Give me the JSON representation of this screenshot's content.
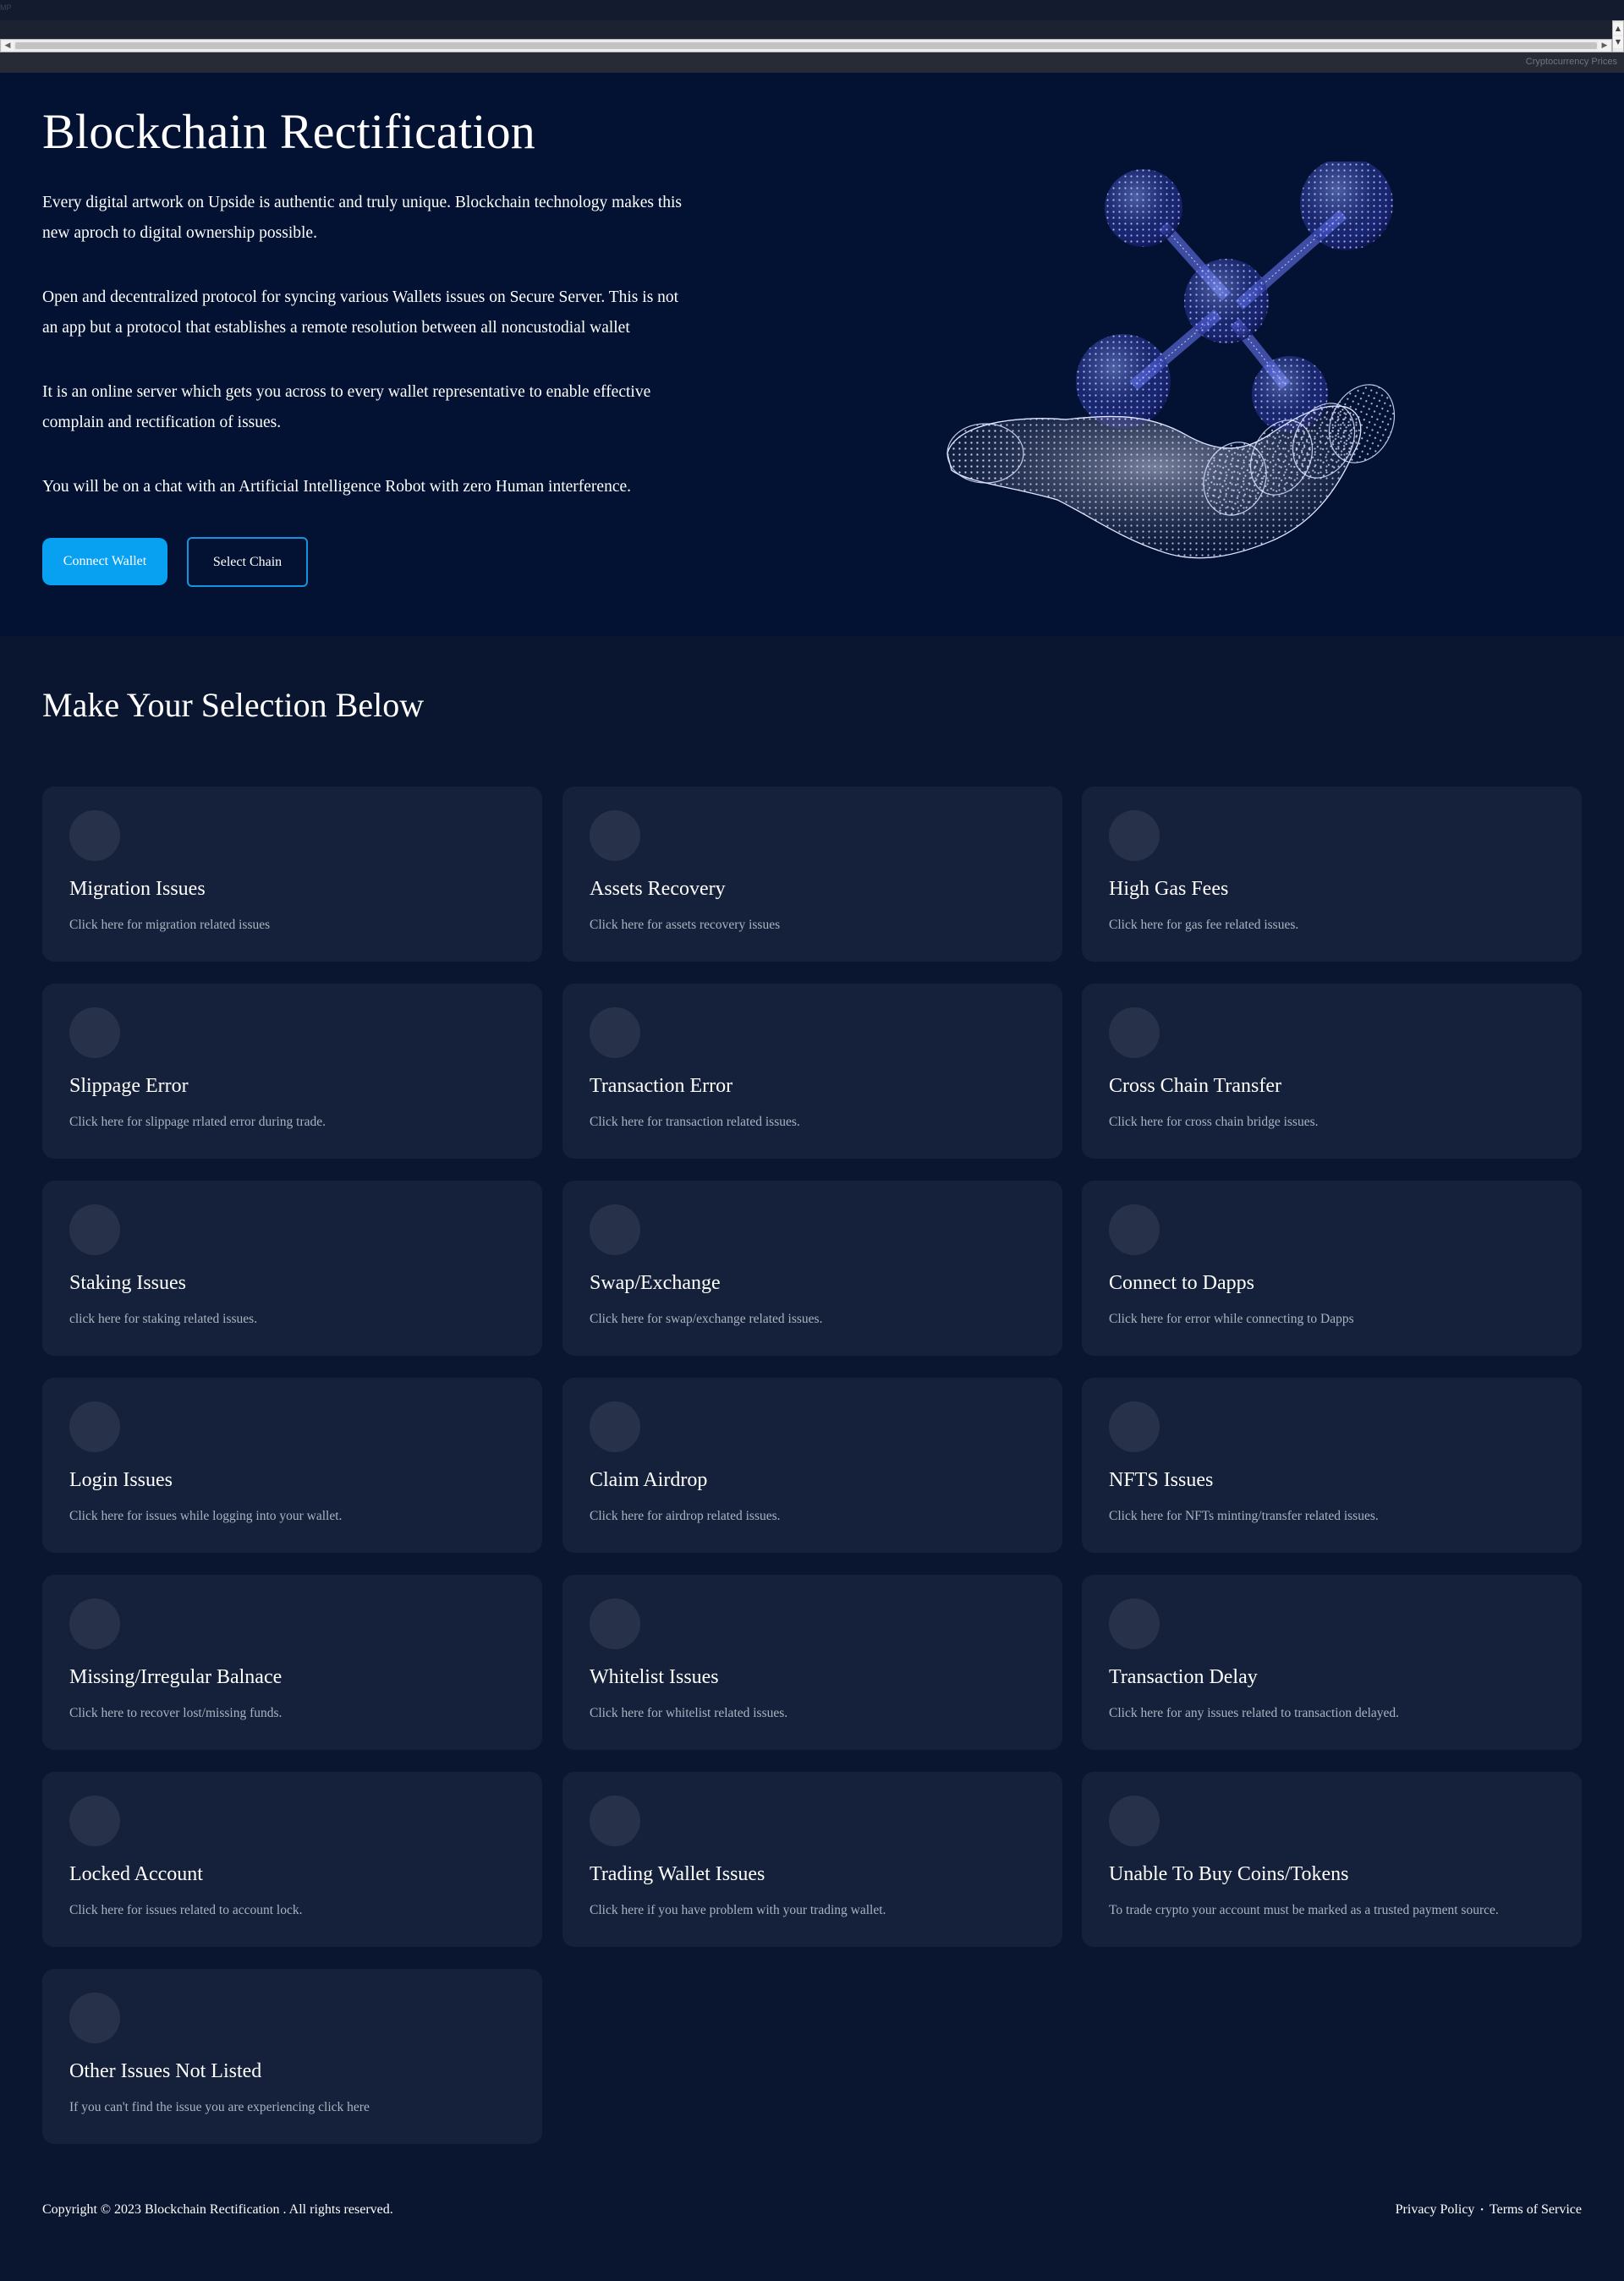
{
  "top_widget": {
    "corner_text": "MP",
    "credit": "Cryptocurrency Prices"
  },
  "hero": {
    "title": "Blockchain Rectification",
    "paragraphs": [
      "Every digital artwork on Upside is authentic and truly unique. Blockchain technology makes this new aproch to digital ownership possible.",
      "Open and decentralized protocol for syncing various Wallets issues on Secure Server. This is not an app but a protocol that establishes a remote resolution between all noncustodial wallet",
      "It is an online server which gets you across to every wallet representative to enable effective complain and rectification of issues.",
      "You will be on a chat with an Artificial Intelligence Robot with zero Human interference."
    ],
    "connect_button": "Connect Wallet",
    "chain_button": "Select Chain",
    "accent_color": "#08a0f0"
  },
  "selection": {
    "title": "Make Your Selection Below",
    "cards": [
      {
        "title": "Migration Issues",
        "desc": "Click here for migration related issues"
      },
      {
        "title": "Assets Recovery",
        "desc": "Click here for assets recovery issues"
      },
      {
        "title": "High Gas Fees",
        "desc": "Click here for gas fee related issues."
      },
      {
        "title": "Slippage Error",
        "desc": "Click here for slippage rrlated error during trade."
      },
      {
        "title": "Transaction Error",
        "desc": "Click here for transaction related issues."
      },
      {
        "title": "Cross Chain Transfer",
        "desc": "Click here for cross chain bridge issues."
      },
      {
        "title": "Staking Issues",
        "desc": "click here for staking related issues."
      },
      {
        "title": "Swap/Exchange",
        "desc": "Click here for swap/exchange related issues."
      },
      {
        "title": "Connect to Dapps",
        "desc": "Click here for error while connecting to Dapps"
      },
      {
        "title": "Login Issues",
        "desc": "Click here for issues while logging into your wallet."
      },
      {
        "title": "Claim Airdrop",
        "desc": "Click here for airdrop related issues."
      },
      {
        "title": "NFTS Issues",
        "desc": "Click here for NFTs minting/transfer related issues."
      },
      {
        "title": "Missing/Irregular Balnace",
        "desc": "Click here to recover lost/missing funds."
      },
      {
        "title": "Whitelist Issues",
        "desc": "Click here for whitelist related issues."
      },
      {
        "title": "Transaction Delay",
        "desc": "Click here for any issues related to transaction delayed."
      },
      {
        "title": "Locked Account",
        "desc": "Click here for issues related to account lock."
      },
      {
        "title": "Trading Wallet Issues",
        "desc": "Click here if you have problem with your trading wallet."
      },
      {
        "title": "Unable To Buy Coins/Tokens",
        "desc": "To trade crypto your account must be marked as a trusted payment source."
      },
      {
        "title": "Other Issues Not Listed",
        "desc": "If you can't find the issue you are experiencing click here"
      }
    ]
  },
  "footer": {
    "copyright": "Copyright © 2023 Blockchain Rectification . All rights reserved.",
    "privacy": "Privacy Policy",
    "separator": "•",
    "terms": "Terms of Service"
  }
}
